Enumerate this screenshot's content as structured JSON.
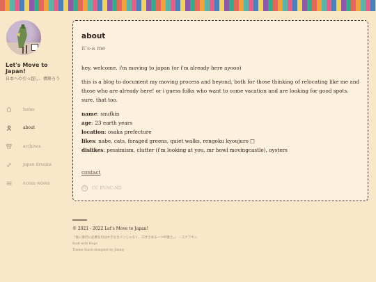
{
  "site": {
    "title": "Let's Move to Japan!",
    "description": "日本への引っ越し、構築ろう"
  },
  "nav": [
    {
      "label": "home",
      "icon": "home-icon"
    },
    {
      "label": "about",
      "icon": "user-icon",
      "active": true
    },
    {
      "label": "archives",
      "icon": "archive-icon"
    },
    {
      "label": "japan dreams",
      "icon": "link-icon"
    },
    {
      "label": "ocean waves",
      "icon": "waves-icon"
    }
  ],
  "page": {
    "title": "about",
    "subtitle": "it's-a me",
    "intro": "hey, welcome. i'm moving to japan (or i'm already here ayooo)",
    "paragraph": "this is a blog to document my moving process and beyond, both for those thinking of relocating like me and those who are already here! or i guess folks who want to come vacation and are looking for good spots. sure, that too.",
    "info": [
      {
        "label": "name",
        "value": "snufkin"
      },
      {
        "label": "age",
        "value": "23 earth years"
      },
      {
        "label": "location",
        "value": "osaka prefecture"
      },
      {
        "label": "likes",
        "value": "nabe, cats, foraged greens, quiet walks, rengoku kyoujuro □"
      },
      {
        "label": "dislikes",
        "value": "pessimism, clutter (i'm looking at you, mr howl movingcastle), oysters"
      }
    ],
    "contact": "contact",
    "license": "CC BY-NC-ND"
  },
  "footer": {
    "copyright": "© 2021 - 2022 Let's Move to Japan!",
    "quote": "「長い旅行に必要なのは大きなカバンじゃなく、口ずさめる一つの歌さ。」 ―スナフキン",
    "built": "Built with Hugo",
    "theme": "Theme Stack designed by Jimmy"
  },
  "colors": {
    "background": "#f9e7c9",
    "card": "#fdf0dc",
    "text": "#3b3128",
    "muted": "#a69585"
  }
}
